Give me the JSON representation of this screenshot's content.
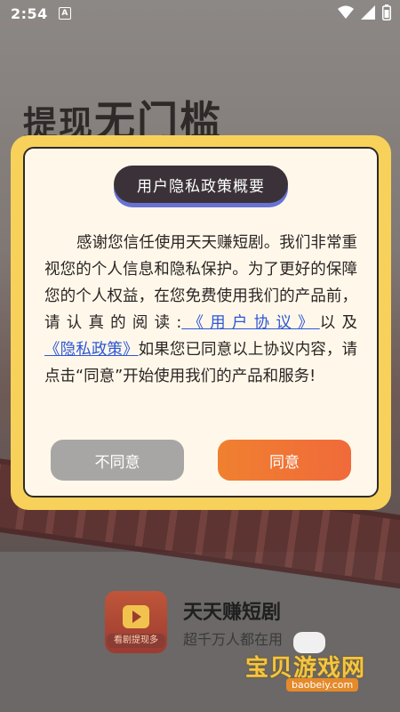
{
  "status_bar": {
    "time": "2:54",
    "notification_icon": "A",
    "icons": [
      "wifi-icon",
      "signal-icon",
      "battery-icon"
    ]
  },
  "background": {
    "headline_part1": "提现",
    "headline_part2": "无门槛"
  },
  "dialog": {
    "title": "用户隐私政策概要",
    "body_intro": "感谢您信任使用天天赚短剧。我们非常重视您的个人信息和隐私保护。为了更好的保障您的个人权益，在您免费使用我们的产品前，请认真的阅读:",
    "link_user_agreement": "《用户协议》",
    "body_middle": "以及",
    "link_privacy_policy": "《隐私政策》",
    "body_end": "如果您已同意以上协议内容，请点击“同意”开始使用我们的产品和服务!",
    "disagree_label": "不同意",
    "agree_label": "同意",
    "accent_color": "#f07434",
    "title_bg": "#3a3238"
  },
  "app_info": {
    "icon_tag": "看剧提现多",
    "name": "天天赚短剧",
    "slogan": "超千万人都在用"
  },
  "watermark": {
    "title": "宝贝游戏网",
    "url": "baobeiy.com"
  }
}
